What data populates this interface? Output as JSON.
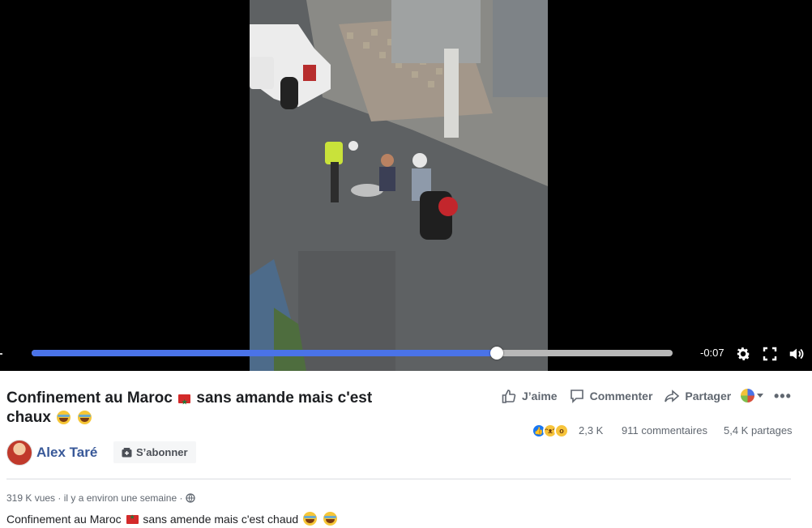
{
  "player": {
    "time_remaining": "-0:07",
    "progress": 0.725,
    "icons": [
      "gear-icon",
      "fullscreen-icon",
      "volume-icon"
    ]
  },
  "post": {
    "title_part1": "Confinement au Maroc",
    "title_part2": "sans amande mais c'est",
    "title_part3": "chaux",
    "author": "Alex Taré",
    "subscribe_label": "S’abonner",
    "meta": "319 K vues · il y a environ une semaine ·",
    "desc_part1": "Confinement au Maroc",
    "desc_part2": "sans amende mais c'est chaud"
  },
  "actions": {
    "like": "J’aime",
    "comment": "Commenter",
    "share": "Partager"
  },
  "stats": {
    "reactions": "2,3 K",
    "comments": "911 commentaires",
    "shares": "5,4 K partages"
  },
  "colors": {
    "accent": "#4a73e8",
    "link": "#385898",
    "text_secondary": "#606770"
  }
}
